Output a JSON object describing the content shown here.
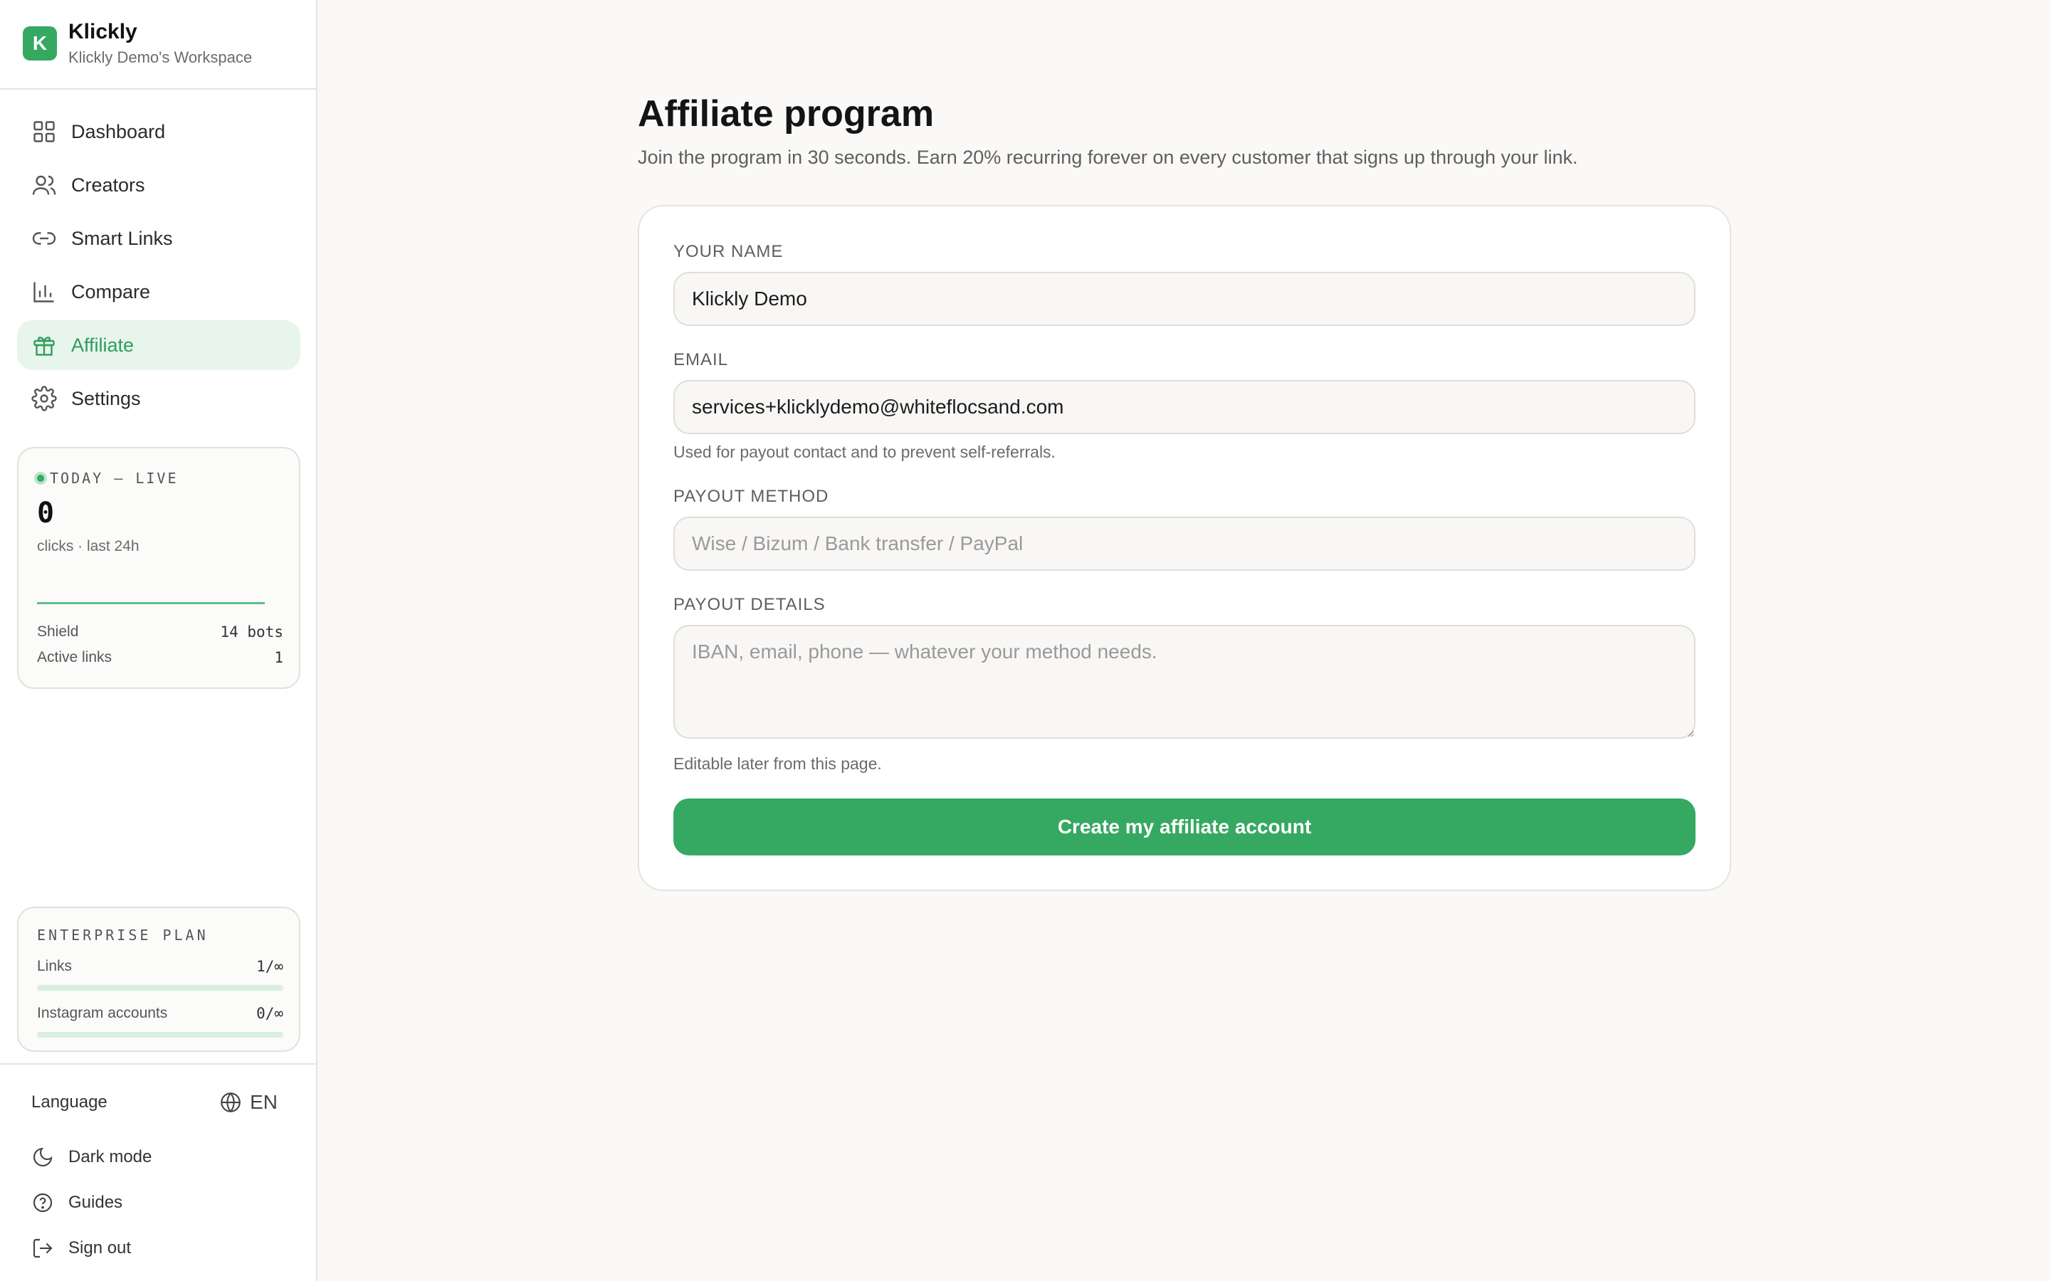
{
  "brand": {
    "logo_letter": "K",
    "name": "Klickly",
    "workspace": "Klickly Demo's Workspace"
  },
  "nav": {
    "items": [
      {
        "label": "Dashboard",
        "icon": "grid-icon"
      },
      {
        "label": "Creators",
        "icon": "users-icon"
      },
      {
        "label": "Smart Links",
        "icon": "link-icon"
      },
      {
        "label": "Compare",
        "icon": "bar-chart-icon"
      },
      {
        "label": "Affiliate",
        "icon": "gift-icon",
        "active": true
      },
      {
        "label": "Settings",
        "icon": "gear-icon"
      }
    ]
  },
  "live": {
    "heading": "TODAY — LIVE",
    "count": "0",
    "subtitle": "clicks · last 24h",
    "shield_label": "Shield",
    "shield_value": "14 bots",
    "active_links_label": "Active links",
    "active_links_value": "1"
  },
  "plan": {
    "title": "ENTERPRISE PLAN",
    "links_label": "Links",
    "links_value": "1/∞",
    "instagram_label": "Instagram accounts",
    "instagram_value": "0/∞"
  },
  "footer": {
    "language_label": "Language",
    "language_value": "EN",
    "dark_mode": "Dark mode",
    "guides": "Guides",
    "sign_out": "Sign out"
  },
  "page": {
    "title": "Affiliate program",
    "subtitle": "Join the program in 30 seconds. Earn 20% recurring forever on every customer that signs up through your link."
  },
  "form": {
    "name_label": "YOUR NAME",
    "name_value": "Klickly Demo",
    "email_label": "EMAIL",
    "email_value": "services+klicklydemo@whiteflocsand.com",
    "email_help": "Used for payout contact and to prevent self-referrals.",
    "method_label": "PAYOUT METHOD",
    "method_placeholder": "Wise / Bizum / Bank transfer / PayPal",
    "details_label": "PAYOUT DETAILS",
    "details_placeholder": "IBAN, email, phone — whatever your method needs.",
    "details_help": "Editable later from this page.",
    "submit_label": "Create my affiliate account"
  },
  "colors": {
    "accent": "#35a862",
    "accent_soft": "#e7f5ec",
    "background": "#faf9f7"
  }
}
